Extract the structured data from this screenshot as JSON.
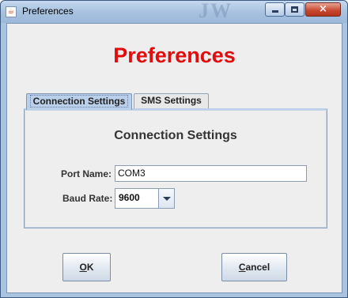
{
  "window": {
    "title": "Preferences",
    "watermark": "JW",
    "controls": {
      "minimize": "minimize",
      "maximize": "maximize",
      "close": "×"
    }
  },
  "dialog": {
    "heading": "Preferences",
    "heading_color": "#e20c0c"
  },
  "tabs": [
    {
      "label": "Connection Settings",
      "selected": true
    },
    {
      "label": "SMS Settings",
      "selected": false
    }
  ],
  "connection": {
    "title": "Connection Settings",
    "port_label": "Port Name:",
    "port_value": "COM3",
    "baud_label": "Baud Rate:",
    "baud_value": "9600"
  },
  "buttons": {
    "ok": {
      "mnemonic": "O",
      "rest": "K"
    },
    "cancel": {
      "mnemonic": "C",
      "rest": "ancel"
    }
  },
  "icons": {
    "app": "java-icon",
    "dropdown": "chevron-down-icon"
  }
}
